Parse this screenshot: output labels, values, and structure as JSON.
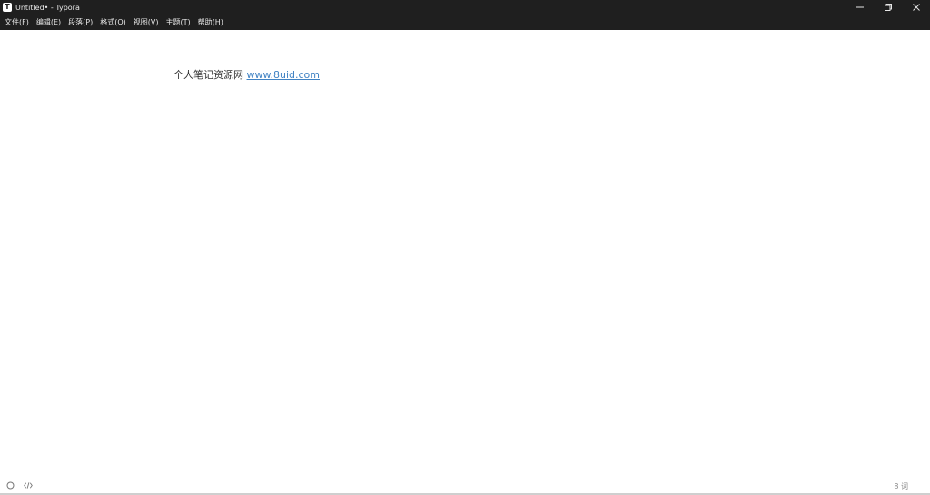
{
  "window": {
    "title": "Untitled• - Typora",
    "app_icon_letter": "T",
    "controls": {
      "minimize": "minimize-icon",
      "restore": "restore-icon",
      "close": "close-icon"
    }
  },
  "menubar": {
    "items": [
      {
        "label": "文件(F)"
      },
      {
        "label": "编辑(E)"
      },
      {
        "label": "段落(P)"
      },
      {
        "label": "格式(O)"
      },
      {
        "label": "视图(V)"
      },
      {
        "label": "主题(T)"
      },
      {
        "label": "帮助(H)"
      }
    ]
  },
  "editor": {
    "text": "个人笔记资源网 ",
    "link_text": "www.8uid.com"
  },
  "statusbar": {
    "left_icons": [
      "circle-icon",
      "source-code-icon"
    ],
    "word_count": "8 词"
  },
  "colors": {
    "chrome_bg": "#1f1f1f",
    "chrome_text": "#e6e6e6",
    "link": "#4183c4",
    "body_text": "#333333"
  }
}
